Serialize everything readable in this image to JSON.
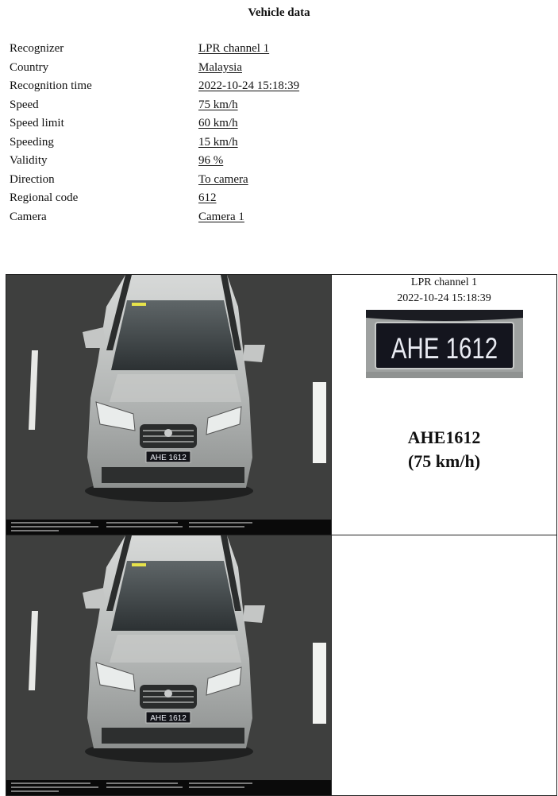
{
  "header": {
    "title": "Vehicle data"
  },
  "fields": [
    {
      "label": "Recognizer",
      "value": "LPR channel  1"
    },
    {
      "label": "Country",
      "value": "Malaysia"
    },
    {
      "label": "Recognition time",
      "value": "2022-10-24 15:18:39"
    },
    {
      "label": "Speed",
      "value": "75 km/h"
    },
    {
      "label": "Speed limit",
      "value": "60 km/h"
    },
    {
      "label": "Speeding",
      "value": "15 km/h"
    },
    {
      "label": "Validity",
      "value": "96 %"
    },
    {
      "label": "Direction",
      "value": "To camera"
    },
    {
      "label": "Regional code",
      "value": "612"
    },
    {
      "label": "Camera",
      "value": "Camera 1"
    }
  ],
  "capture": {
    "channel": "LPR channel  1",
    "time": "2022-10-24 15:18:39",
    "plate_text": "AHE 1612",
    "plate_number": "AHE1612",
    "speed_label": "(75 km/h)"
  },
  "colors": {
    "road": "#3a3b3a",
    "car_body": "#b9bcbb",
    "plate_bg": "#14151e",
    "plate_text": "#e9ebf2"
  }
}
